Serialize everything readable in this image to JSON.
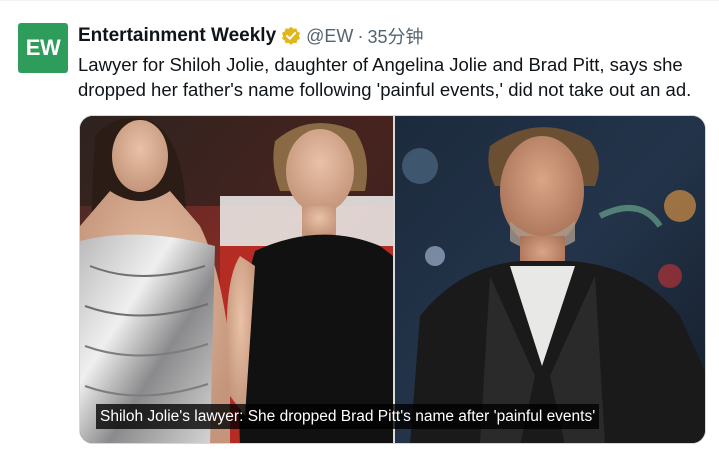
{
  "tweet": {
    "avatar_text": "EW",
    "author_name": "Entertainment Weekly",
    "handle": "@EW",
    "separator": "·",
    "time": "35分钟",
    "text": "Lawyer for Shiloh Jolie, daughter of Angelina Jolie and Brad Pitt, says she dropped her father's name following 'painful events,' did not take out an ad.",
    "media_caption": "Shiloh Jolie's lawyer: She dropped Brad Pitt's name after 'painful events'"
  },
  "colors": {
    "avatar_bg": "#2e9c5a",
    "verified_badge": "#e2b719",
    "secondary_text": "#536471"
  },
  "icons": {
    "verified": "verified-badge-icon"
  }
}
